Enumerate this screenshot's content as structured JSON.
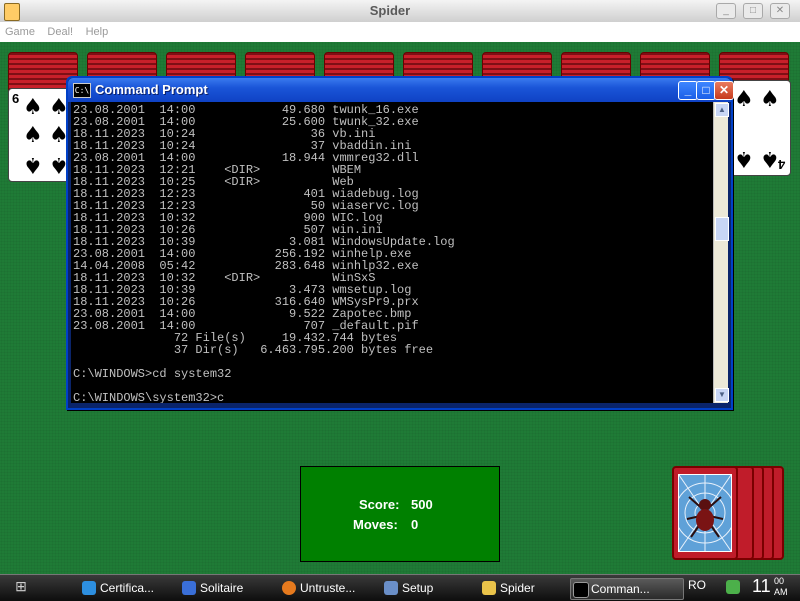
{
  "app": {
    "title": "Spider",
    "minimize": "_",
    "maximize": "□",
    "close": "✕",
    "menu": [
      "Game",
      "Deal!",
      "Help"
    ]
  },
  "cards": {
    "first_face_rank": "6",
    "first_face_suit": "♠",
    "last_face_rank": "4",
    "last_face_suit": "♠"
  },
  "cmd": {
    "title": "Command Prompt",
    "icon_text": "C:\\",
    "minimize": "_",
    "maximize": "□",
    "close": "✕",
    "lines": [
      "23.08.2001  14:00            49.680 twunk_16.exe",
      "23.08.2001  14:00            25.600 twunk_32.exe",
      "18.11.2023  10:24                36 vb.ini",
      "18.11.2023  10:24                37 vbaddin.ini",
      "23.08.2001  14:00            18.944 vmmreg32.dll",
      "18.11.2023  12:21    <DIR>          WBEM",
      "18.11.2023  10:25    <DIR>          Web",
      "18.11.2023  12:23               401 wiadebug.log",
      "18.11.2023  12:23                50 wiaservc.log",
      "18.11.2023  10:32               900 WIC.log",
      "18.11.2023  10:26               507 win.ini",
      "18.11.2023  10:39             3.081 WindowsUpdate.log",
      "23.08.2001  14:00           256.192 winhelp.exe",
      "14.04.2008  05:42           283.648 winhlp32.exe",
      "18.11.2023  10:32    <DIR>          WinSxS",
      "18.11.2023  10:39             3.473 wmsetup.log",
      "18.11.2023  10:26           316.640 WMSysPr9.prx",
      "23.08.2001  14:00             9.522 Zapotec.bmp",
      "23.08.2001  14:00               707 _default.pif",
      "              72 File(s)     19.432.744 bytes",
      "              37 Dir(s)   6.463.795.200 bytes free",
      "",
      "C:\\WINDOWS>cd system32",
      "",
      "C:\\WINDOWS\\system32>c"
    ]
  },
  "score": {
    "score_label": "Score:",
    "score_value": "500",
    "moves_label": "Moves:",
    "moves_value": "0"
  },
  "taskbar": {
    "items": [
      "Certifica...",
      "Solitaire",
      "Untruste...",
      "Setup",
      "Spider",
      "Comman..."
    ],
    "language": "RO",
    "time": "11",
    "time_suffix_top": "00",
    "time_suffix_bottom": "AM"
  },
  "colors": {
    "felt": "#1f7b36",
    "titlebar_blue": "#1a55d8",
    "score_green": "#008000",
    "card_red": "#c01c1c"
  }
}
